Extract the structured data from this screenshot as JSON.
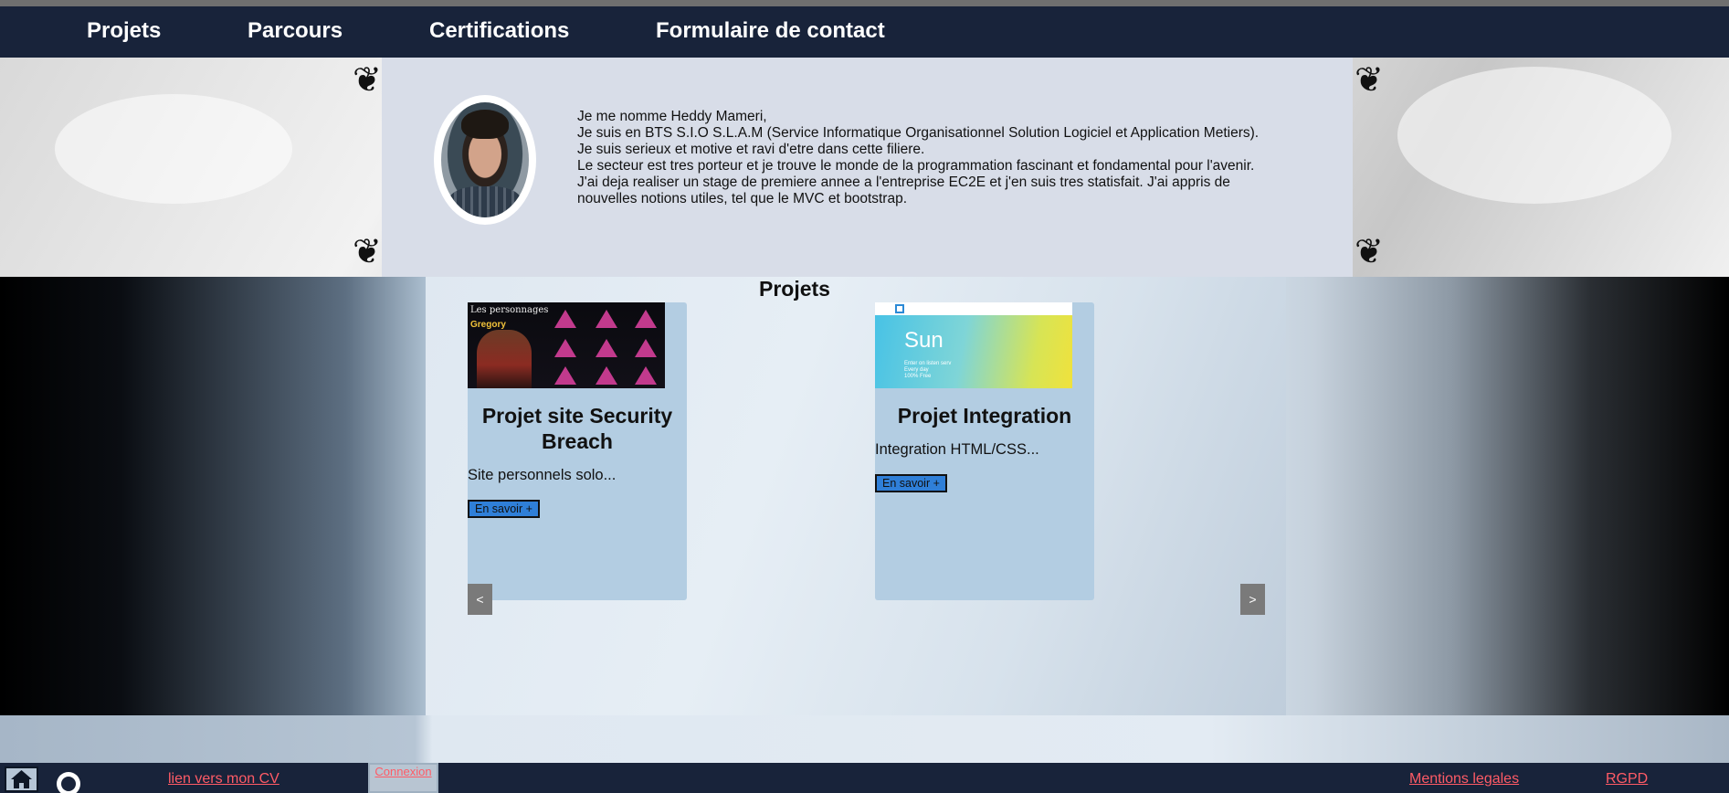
{
  "nav": {
    "items": [
      {
        "label": "Projets"
      },
      {
        "label": "Parcours"
      },
      {
        "label": "Certifications"
      },
      {
        "label": "Formulaire de contact"
      }
    ]
  },
  "intro": {
    "bio_lines": [
      "Je me nomme Heddy Mameri,",
      "Je suis en BTS S.I.O S.L.A.M (Service Informatique Organisationnel Solution Logiciel et Application Metiers).",
      "Je suis serieux et motive et ravi d'etre dans cette filiere.",
      "Le secteur est tres porteur et je trouve le monde de la programmation fascinant et fondamental pour l'avenir.",
      "J'ai deja realiser un stage de premiere annee a l'entreprise EC2E et j'en suis tres statisfait. J'ai appris de nouvelles notions utiles, tel que le MVC et bootstrap."
    ]
  },
  "projects": {
    "title": "Projets",
    "cards": [
      {
        "title": "Projet site Security Breach",
        "description": "Site personnels solo...",
        "button_label": "En savoir +",
        "thumb_text_1": "Les personnages",
        "thumb_text_2": "Gregory"
      },
      {
        "title": "Projet Integration",
        "description": "Integration HTML/CSS...",
        "button_label": "En savoir +",
        "thumb_text_1": "Sun",
        "thumb_text_2": "Enter on listen serv\nEvery day\n100% Free"
      }
    ],
    "prev_label": "<",
    "next_label": ">"
  },
  "footer": {
    "cv_link": "lien vers mon CV",
    "login_label": "Connexion",
    "legal_link": "Mentions legales",
    "rgpd_link": "RGPD"
  }
}
